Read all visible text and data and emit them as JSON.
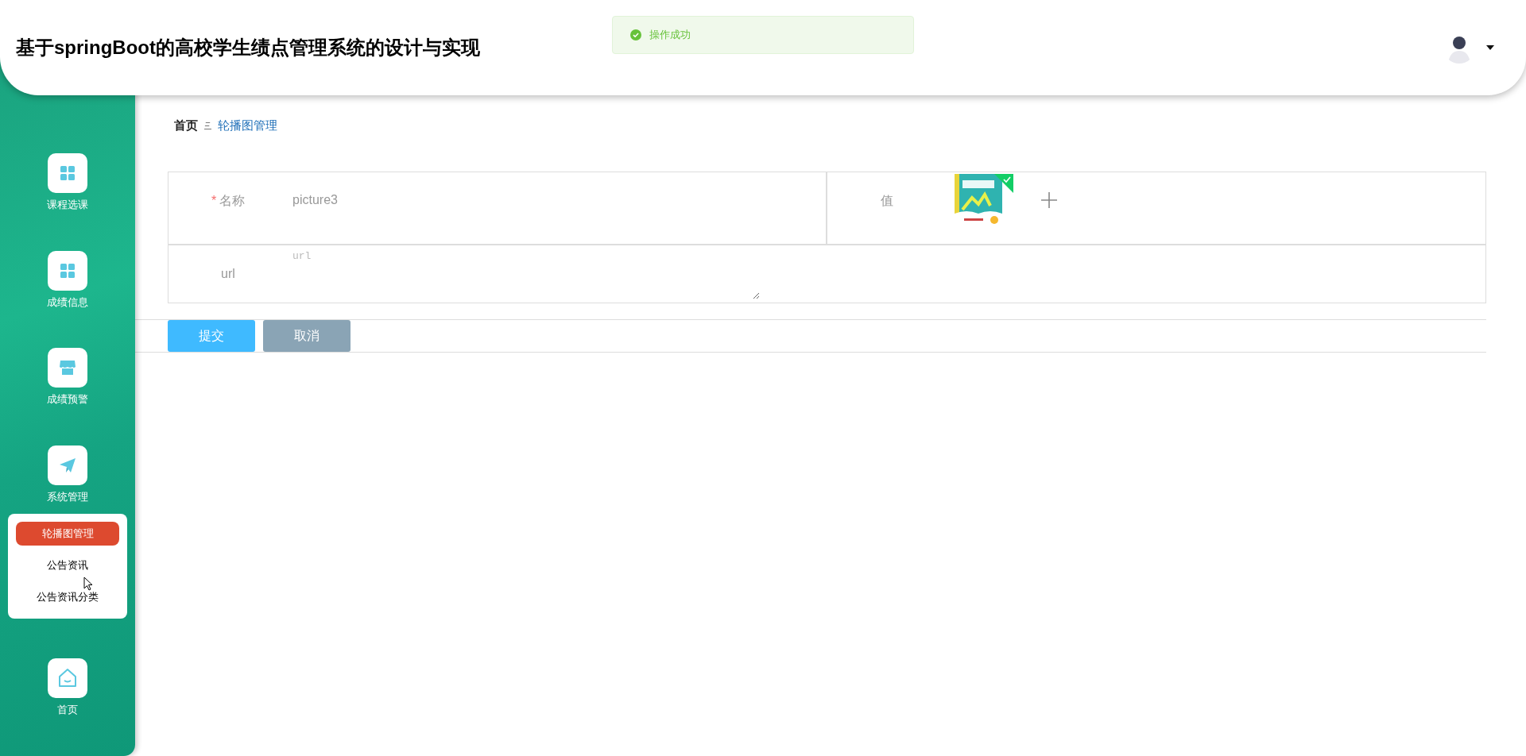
{
  "header": {
    "title": "基于springBoot的高校学生绩点管理系统的设计与实现"
  },
  "toast": {
    "kind": "success",
    "message": "操作成功"
  },
  "sidebar": {
    "items": [
      {
        "label": "课程选课"
      },
      {
        "label": "成绩信息"
      },
      {
        "label": "成绩预警"
      },
      {
        "label": "系统管理",
        "expanded": true,
        "children": [
          {
            "label": "轮播图管理",
            "selected": true
          },
          {
            "label": "公告资讯",
            "selected": false
          },
          {
            "label": "公告资讯分类",
            "selected": false
          }
        ]
      },
      {
        "label": "首页"
      }
    ]
  },
  "breadcrumb": [
    {
      "label": "首页"
    },
    {
      "label": "轮播图管理"
    }
  ],
  "form": {
    "fields": [
      {
        "kind": "text",
        "required_mark": "*",
        "label": "名称",
        "value": "picture3"
      },
      {
        "label": "值",
        "image": {
          "kind": "picture",
          "uploaded": true
        }
      },
      {
        "kind": "textarea",
        "label": "url",
        "placeholder": "url"
      }
    ],
    "buttons": [
      {
        "label": "提交",
        "kind": "primary"
      },
      {
        "label": "取消",
        "kind": "secondary"
      }
    ]
  }
}
